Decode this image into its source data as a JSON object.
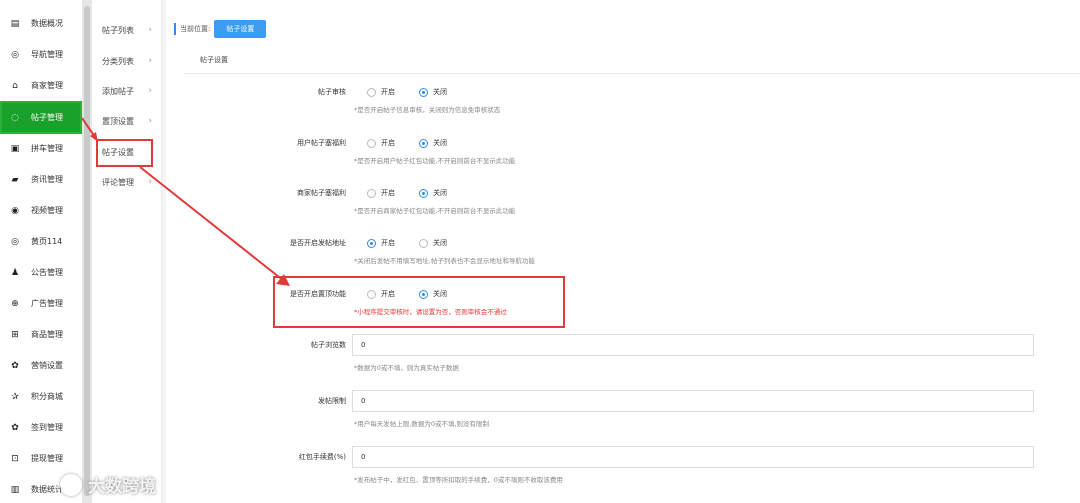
{
  "sidebar": {
    "items": [
      {
        "label": "数据概况",
        "icon": "dashboard-icon",
        "glyph": "▤"
      },
      {
        "label": "导航管理",
        "icon": "compass-icon",
        "glyph": "◎"
      },
      {
        "label": "商家管理",
        "icon": "bank-icon",
        "glyph": "⌂"
      },
      {
        "label": "帖子管理",
        "icon": "comment-icon",
        "glyph": "◌",
        "active": true
      },
      {
        "label": "拼车管理",
        "icon": "car-icon",
        "glyph": "▣"
      },
      {
        "label": "资讯管理",
        "icon": "book-icon",
        "glyph": "▰"
      },
      {
        "label": "视频管理",
        "icon": "play-icon",
        "glyph": "◉"
      },
      {
        "label": "黄页114",
        "icon": "contact-icon",
        "glyph": "◎"
      },
      {
        "label": "公告管理",
        "icon": "bell-icon",
        "glyph": "♟"
      },
      {
        "label": "广告管理",
        "icon": "ad-icon",
        "glyph": "⊕"
      },
      {
        "label": "商品管理",
        "icon": "cart-icon",
        "glyph": "⊞"
      },
      {
        "label": "营销设置",
        "icon": "gift-icon",
        "glyph": "✿"
      },
      {
        "label": "积分商城",
        "icon": "star-icon",
        "glyph": "✰"
      },
      {
        "label": "签到管理",
        "icon": "gift-icon",
        "glyph": "✿"
      },
      {
        "label": "提现管理",
        "icon": "cash-icon",
        "glyph": "⊡"
      },
      {
        "label": "数据统计",
        "icon": "chart-icon",
        "glyph": "▥"
      }
    ]
  },
  "submenu": {
    "items": [
      {
        "label": "帖子列表",
        "chevron": true
      },
      {
        "label": "分类列表",
        "chevron": true
      },
      {
        "label": "添加帖子",
        "chevron": true
      },
      {
        "label": "置顶设置",
        "chevron": true
      },
      {
        "label": "帖子设置",
        "chevron": false
      },
      {
        "label": "评论管理",
        "chevron": true
      }
    ],
    "chevron_glyph": "›"
  },
  "breadcrumb": {
    "prefix": "当前位置:",
    "current": "帖子设置"
  },
  "section_title": "帖子设置",
  "options": {
    "on": "开启",
    "off": "关闭"
  },
  "settings": [
    {
      "label": "帖子审核",
      "selected": "off",
      "hint": "*是否开启帖子信息审核，关闭则为信息免审核状态"
    },
    {
      "label": "用户帖子塞福利",
      "selected": "off",
      "hint": "*是否开启用户帖子红包功能,不开启则前台不显示此功能"
    },
    {
      "label": "商家帖子塞福利",
      "selected": "off",
      "hint": "*是否开启商家帖子红包功能,不开启则前台不显示此功能"
    },
    {
      "label": "是否开启发帖地址",
      "selected": "on",
      "hint": "*关闭后发帖不用填写地址,帖子列表也不会显示地址和导航功能"
    },
    {
      "label": "是否开启置顶功能",
      "selected": "off",
      "hint": "*小程序提交审核时，请设置为否，否则审核会不通过"
    }
  ],
  "inputs": [
    {
      "label": "帖子浏览数",
      "value": "0",
      "hint": "*数据为0或不填，则为真实帖子数据"
    },
    {
      "label": "发帖限制",
      "value": "0",
      "hint": "*用户每天发帖上限,数据为0或不填,则没有限制"
    },
    {
      "label": "红包手续费(%)",
      "value": "0",
      "hint": "*发布帖子中，发红包、置顶等所扣取的手续费，0或不填则不收取该费用"
    }
  ],
  "watermark": "大数跨境",
  "colors": {
    "active_green": "#19a12b",
    "accent_blue": "#2f8ef0",
    "annotation_red": "#e13a3a"
  }
}
